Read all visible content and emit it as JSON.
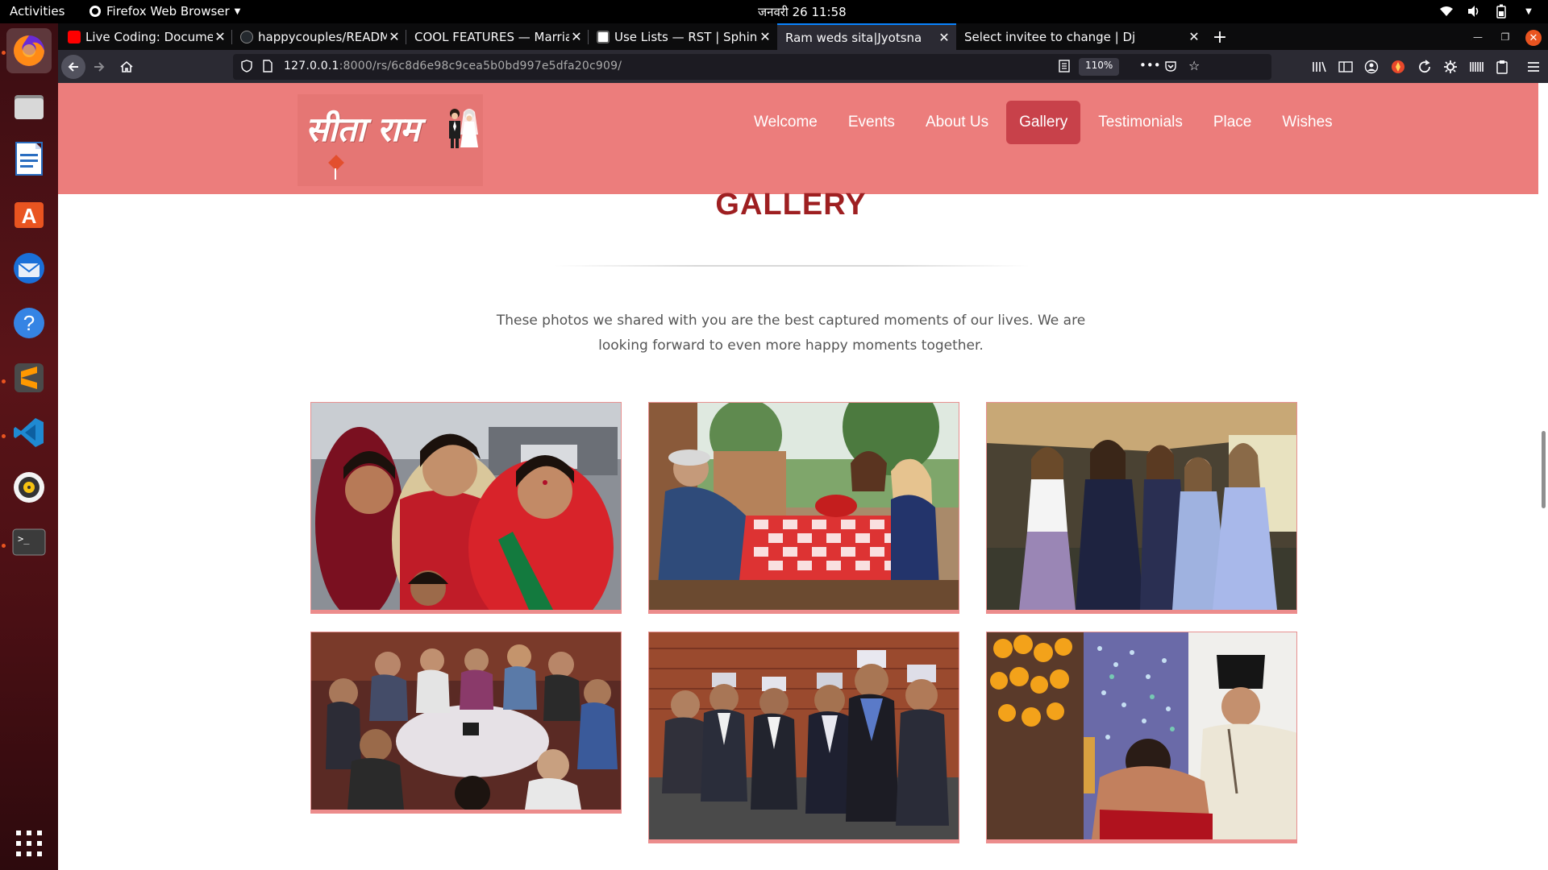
{
  "system_bar": {
    "activities": "Activities",
    "app_name": "Firefox Web Browser",
    "clock": "जनवरी 26  11:58"
  },
  "dock": {
    "items": [
      "firefox",
      "files",
      "libreoffice-writer",
      "ubuntu-software",
      "thunderbird",
      "help",
      "sublime-text",
      "vscode",
      "rhythmbox",
      "terminal"
    ]
  },
  "tabs": [
    {
      "title": "Live Coding: Documentat",
      "favicon": "youtube-icon",
      "active": false
    },
    {
      "title": "happycouples/README.",
      "favicon": "github-icon",
      "active": false
    },
    {
      "title": "COOL FEATURES — Marriag",
      "favicon": "none",
      "active": false
    },
    {
      "title": "Use Lists — RST | Sphinx",
      "favicon": "doc-icon",
      "active": false
    },
    {
      "title": "Ram weds sita|Jyotsna",
      "favicon": "none",
      "active": true
    },
    {
      "title": "Select invitee to change | Dj",
      "favicon": "none",
      "active": false
    }
  ],
  "navbar": {
    "url_host": "127.0.0.1",
    "url_path": ":8000/rs/6c8d6e98c9cea5b0bd997e5dfa20c909/",
    "zoom": "110%"
  },
  "site": {
    "logo_text": "सीता राम",
    "menu": [
      {
        "label": "Welcome",
        "active": false
      },
      {
        "label": "Events",
        "active": false
      },
      {
        "label": "About Us",
        "active": false
      },
      {
        "label": "Gallery",
        "active": true
      },
      {
        "label": "Testimonials",
        "active": false
      },
      {
        "label": "Place",
        "active": false
      },
      {
        "label": "Wishes",
        "active": false
      }
    ],
    "gallery": {
      "title": "GALLERY",
      "intro": "These photos we shared with you are the best captured moments of our lives. We are looking forward to even more happy moments together."
    }
  },
  "colors": {
    "header_bg": "#ec7d7c",
    "menu_active_bg": "#c8414a",
    "title_color": "#9e1f21",
    "photo_border": "#ec8c8c"
  }
}
